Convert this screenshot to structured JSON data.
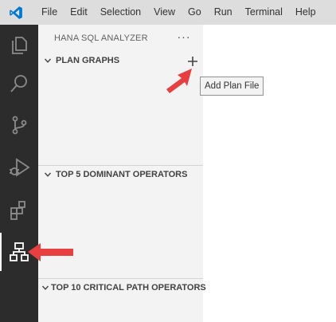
{
  "menu": [
    "File",
    "Edit",
    "Selection",
    "View",
    "Go",
    "Run",
    "Terminal",
    "Help"
  ],
  "sidebar": {
    "title": "HANA SQL ANALYZER",
    "more": "···",
    "sections": [
      {
        "label": "PLAN GRAPHS"
      },
      {
        "label": "TOP 5 DOMINANT OPERATORS"
      },
      {
        "label": "TOP 10 CRITICAL PATH OPERATORS"
      }
    ]
  },
  "tooltip": {
    "text": "Add Plan File"
  },
  "activity_icons": [
    "explorer-icon",
    "search-icon",
    "source-control-icon",
    "run-debug-icon",
    "extensions-icon",
    "hana-analyzer-icon"
  ],
  "colors": {
    "accent_arrow": "#e84040",
    "vscode_blue": "#0078d4",
    "activity_bar": "#2c2c2c",
    "sidebar": "#f3f3f3"
  }
}
